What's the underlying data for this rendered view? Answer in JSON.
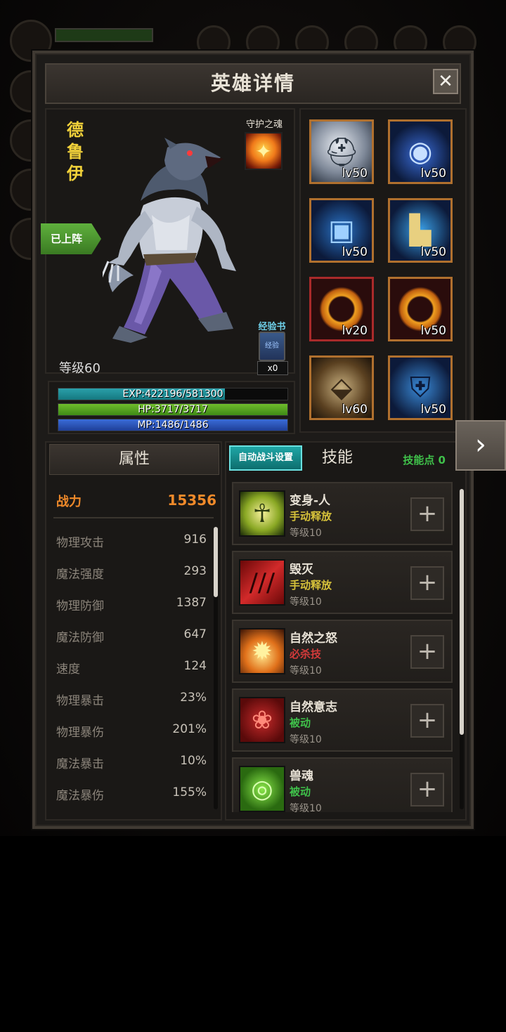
{
  "window": {
    "title": "英雄详情",
    "close_icon": "✕"
  },
  "hero": {
    "name": "德鲁伊",
    "guard_label": "守护之魂",
    "deployed_badge": "已上阵",
    "level_text": "等级60",
    "exp_book": {
      "label": "经验书",
      "icon_text": "经验",
      "count": "x0"
    }
  },
  "bars": {
    "exp": {
      "text": "EXP:422196/581300",
      "fill": 0.726
    },
    "hp": {
      "text": "HP:3717/3717",
      "fill": 1.0
    },
    "mp": {
      "text": "MP:1486/1486",
      "fill": 1.0
    }
  },
  "equipment": [
    {
      "icon": "helmet-icon",
      "level": "lv50",
      "rarity": "orange"
    },
    {
      "icon": "amulet-icon",
      "level": "lv50",
      "rarity": "orange"
    },
    {
      "icon": "armor-icon",
      "level": "lv50",
      "rarity": "orange"
    },
    {
      "icon": "boots-icon",
      "level": "lv50",
      "rarity": "orange"
    },
    {
      "icon": "ring-icon",
      "level": "lv20",
      "rarity": "red"
    },
    {
      "icon": "ring-icon",
      "level": "lv50",
      "rarity": "orange"
    },
    {
      "icon": "bracer-icon",
      "level": "lv60",
      "rarity": "orange"
    },
    {
      "icon": "shield-icon",
      "level": "lv50",
      "rarity": "orange"
    }
  ],
  "attributes": {
    "header": "属性",
    "power": {
      "label": "战力",
      "value": "15356"
    },
    "stats": [
      {
        "label": "物理攻击",
        "value": "916"
      },
      {
        "label": "魔法强度",
        "value": "293"
      },
      {
        "label": "物理防御",
        "value": "1387"
      },
      {
        "label": "魔法防御",
        "value": "647"
      },
      {
        "label": "速度",
        "value": "124"
      },
      {
        "label": "物理暴击",
        "value": "23%"
      },
      {
        "label": "物理暴伤",
        "value": "201%"
      },
      {
        "label": "魔法暴击",
        "value": "10%"
      },
      {
        "label": "魔法暴伤",
        "value": "155%"
      }
    ]
  },
  "skills_panel": {
    "auto_battle_label": "自动战斗设置",
    "tab_label": "技能",
    "skill_points": "技能点 0",
    "skills": [
      {
        "name": "变身-人",
        "type": "手动释放",
        "type_color": "#d7c23a",
        "level": "等级10",
        "icon": "transform-icon",
        "plus": "+"
      },
      {
        "name": "毁灭",
        "type": "手动释放",
        "type_color": "#d7c23a",
        "level": "等级10",
        "icon": "claw-icon",
        "plus": "+"
      },
      {
        "name": "自然之怒",
        "type": "必杀技",
        "type_color": "#d23a3a",
        "level": "等级10",
        "icon": "fire-icon",
        "plus": "+"
      },
      {
        "name": "自然意志",
        "type": "被动",
        "type_color": "#3fc04a",
        "level": "等级10",
        "icon": "paw-icon",
        "plus": "+"
      },
      {
        "name": "兽魂",
        "type": "被动",
        "type_color": "#3fc04a",
        "level": "等级10",
        "icon": "spirit-icon",
        "plus": "+"
      }
    ]
  },
  "next_arrow": "›"
}
